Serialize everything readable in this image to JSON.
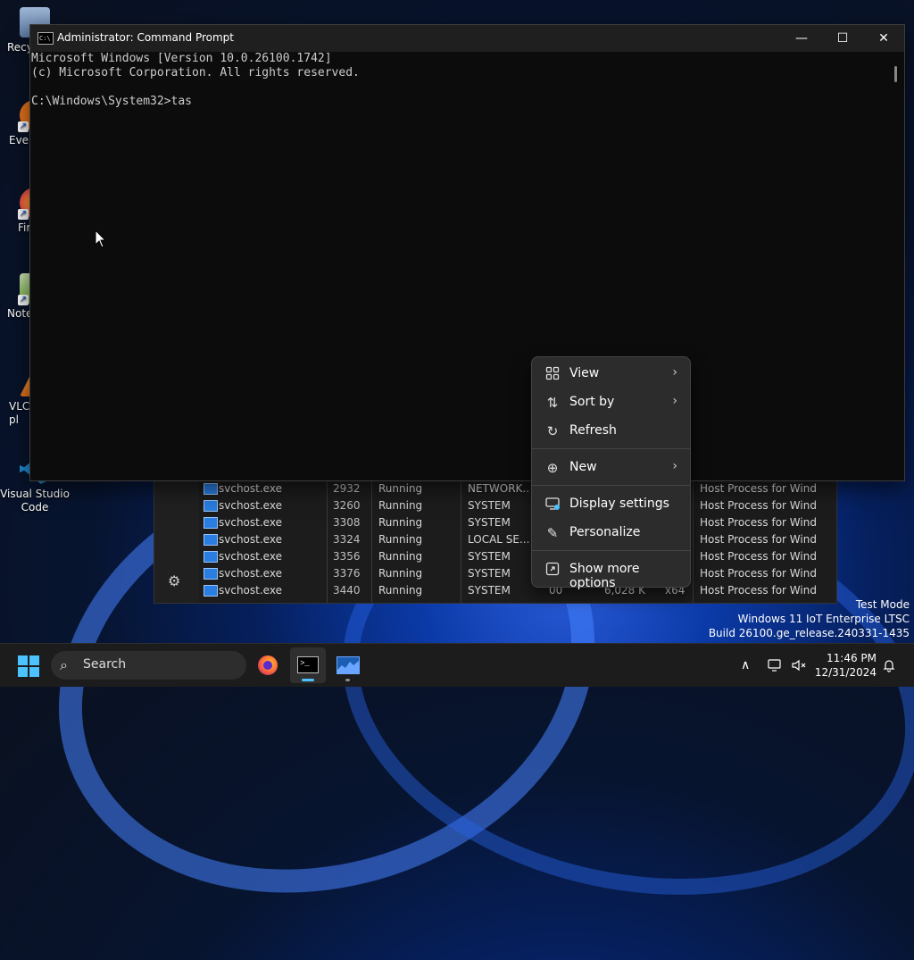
{
  "desktop": {
    "icons": [
      {
        "label": "Recycle Bin",
        "visible_label": "Recy"
      },
      {
        "label": "Everything",
        "visible_label": "Ever"
      },
      {
        "label": "Firefox",
        "visible_label": "Fir"
      },
      {
        "label": "Notepad++",
        "visible_label": "Note"
      },
      {
        "label": "VLC media player",
        "visible_label": "VLC\npl"
      },
      {
        "label": "Visual Studio Code",
        "visible_label": "Visual Studio\nCode"
      }
    ]
  },
  "cmd_window": {
    "title": "Administrator: Command Prompt",
    "lines": [
      "Microsoft Windows [Version 10.0.26100.1742]",
      "(c) Microsoft Corporation. All rights reserved.",
      "",
      "C:\\Windows\\System32>tas"
    ],
    "controls": {
      "minimize": "—",
      "maximize": "☐",
      "close": "✕"
    }
  },
  "task_manager": {
    "rows": [
      {
        "name": "svchost.exe",
        "pid": "2932",
        "status": "Running",
        "user": "NETWORK...",
        "desc": "Host Process for Wind..."
      },
      {
        "name": "svchost.exe",
        "pid": "3260",
        "status": "Running",
        "user": "SYSTEM",
        "desc": "Host Process for Wind..."
      },
      {
        "name": "svchost.exe",
        "pid": "3308",
        "status": "Running",
        "user": "SYSTEM",
        "desc": "Host Process for Wind..."
      },
      {
        "name": "svchost.exe",
        "pid": "3324",
        "status": "Running",
        "user": "LOCAL SE...",
        "desc": "Host Process for Wind..."
      },
      {
        "name": "svchost.exe",
        "pid": "3356",
        "status": "Running",
        "user": "SYSTEM",
        "desc": "Host Process for Wind..."
      },
      {
        "name": "svchost.exe",
        "pid": "3376",
        "status": "Running",
        "user": "SYSTEM",
        "desc": "Host Process for Wind..."
      },
      {
        "name": "svchost.exe",
        "pid": "3440",
        "status": "Running",
        "user": "SYSTEM",
        "cpu": "00",
        "mem": "6,028 K",
        "arch": "x64",
        "desc": "Host Process for Wind..."
      }
    ]
  },
  "context_menu": {
    "items": [
      {
        "label": "View",
        "icon": "grid-icon",
        "submenu": true
      },
      {
        "label": "Sort by",
        "icon": "sort-icon",
        "submenu": true
      },
      {
        "label": "Refresh",
        "icon": "refresh-icon",
        "submenu": false
      },
      {
        "label": "New",
        "icon": "plus-circle-icon",
        "submenu": true
      },
      {
        "label": "Display settings",
        "icon": "display-icon",
        "submenu": false
      },
      {
        "label": "Personalize",
        "icon": "pen-icon",
        "submenu": false
      },
      {
        "label": "Show more options",
        "icon": "more-options-icon",
        "submenu": false
      }
    ]
  },
  "watermark": {
    "line1": "Test Mode",
    "line2": "Windows 11 IoT Enterprise LTSC",
    "line3": "Build 26100.ge_release.240331-1435"
  },
  "taskbar": {
    "search_placeholder": "Search",
    "time": "11:46 PM",
    "date": "12/31/2024"
  }
}
